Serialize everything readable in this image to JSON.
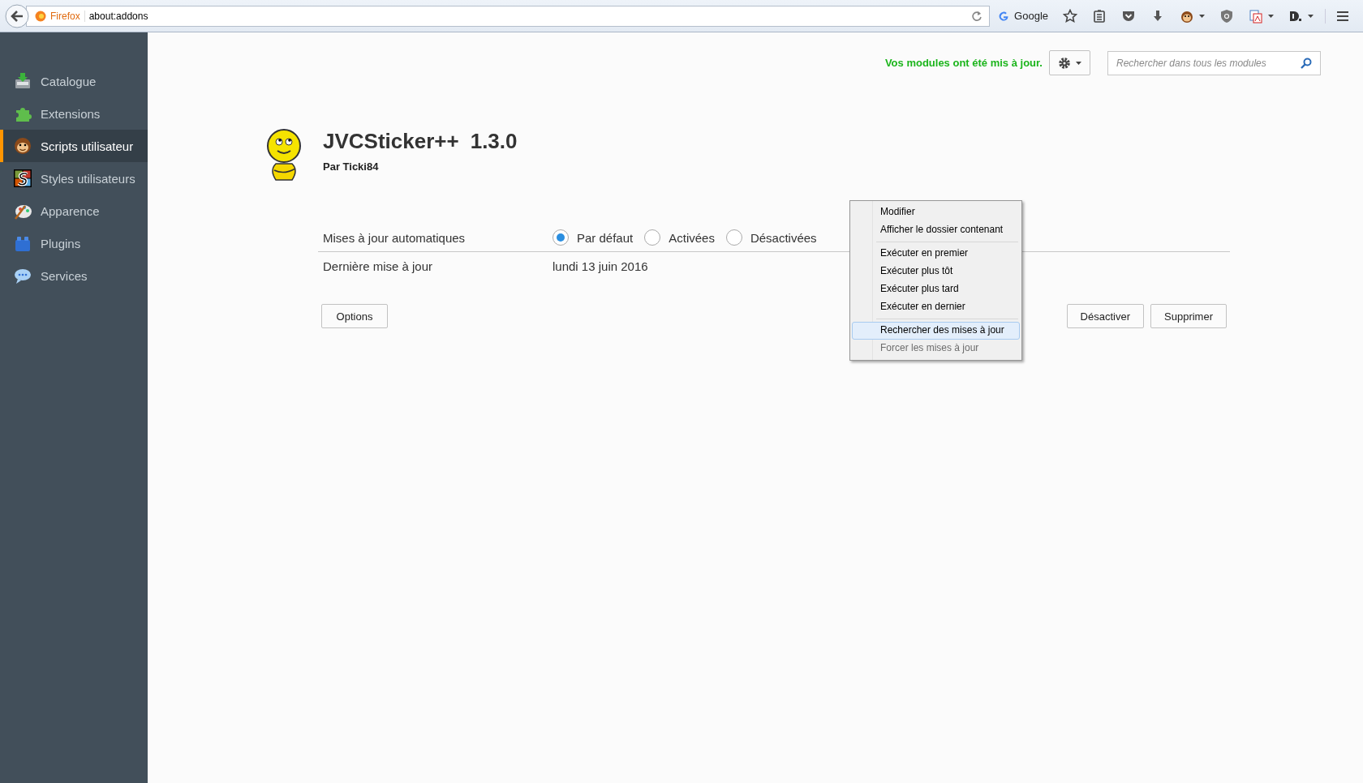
{
  "browser": {
    "identity_label": "Firefox",
    "url": "about:addons",
    "search_engine": "Google"
  },
  "sidebar": {
    "items": [
      {
        "kind": "catalogue",
        "label": "Catalogue",
        "selected": false
      },
      {
        "kind": "extensions",
        "label": "Extensions",
        "selected": false
      },
      {
        "kind": "scripts",
        "label": "Scripts utilisateur",
        "selected": true
      },
      {
        "kind": "styles",
        "label": "Styles utilisateurs",
        "selected": false
      },
      {
        "kind": "appearance",
        "label": "Apparence",
        "selected": false
      },
      {
        "kind": "plugins",
        "label": "Plugins",
        "selected": false
      },
      {
        "kind": "services",
        "label": "Services",
        "selected": false
      }
    ]
  },
  "header": {
    "notice": "Vos modules ont été mis à jour.",
    "search": {
      "placeholder": "Rechercher dans tous les modules"
    }
  },
  "addon": {
    "name": "JVCSticker++",
    "version": "1.3.0",
    "author": "Par Ticki84",
    "details": [
      {
        "kind": "radios",
        "label": "Mises à jour automatiques",
        "options": [
          {
            "label": "Par défaut",
            "selected": true
          },
          {
            "label": "Activées",
            "selected": false
          },
          {
            "label": "Désactivées",
            "selected": false
          }
        ]
      },
      {
        "kind": "text",
        "label": "Dernière mise à jour",
        "value": "lundi 13 juin 2016"
      }
    ],
    "buttons_left": [
      "Options"
    ],
    "buttons_right": [
      "Désactiver",
      "Supprimer"
    ]
  },
  "context_menu": {
    "items": [
      {
        "kind": "item",
        "label": "Modifier",
        "selected": false,
        "disabled": false
      },
      {
        "kind": "item",
        "label": "Afficher le dossier contenant",
        "selected": false,
        "disabled": false
      },
      {
        "kind": "separator"
      },
      {
        "kind": "item",
        "label": "Exécuter en premier",
        "selected": false,
        "disabled": false
      },
      {
        "kind": "item",
        "label": "Exécuter plus tôt",
        "selected": false,
        "disabled": false
      },
      {
        "kind": "item",
        "label": "Exécuter plus tard",
        "selected": false,
        "disabled": false
      },
      {
        "kind": "item",
        "label": "Exécuter en dernier",
        "selected": false,
        "disabled": false
      },
      {
        "kind": "separator"
      },
      {
        "kind": "item",
        "label": "Rechercher des mises à jour",
        "selected": true,
        "disabled": false
      },
      {
        "kind": "item",
        "label": "Forcer les mises à jour",
        "selected": false,
        "disabled": true
      }
    ]
  }
}
